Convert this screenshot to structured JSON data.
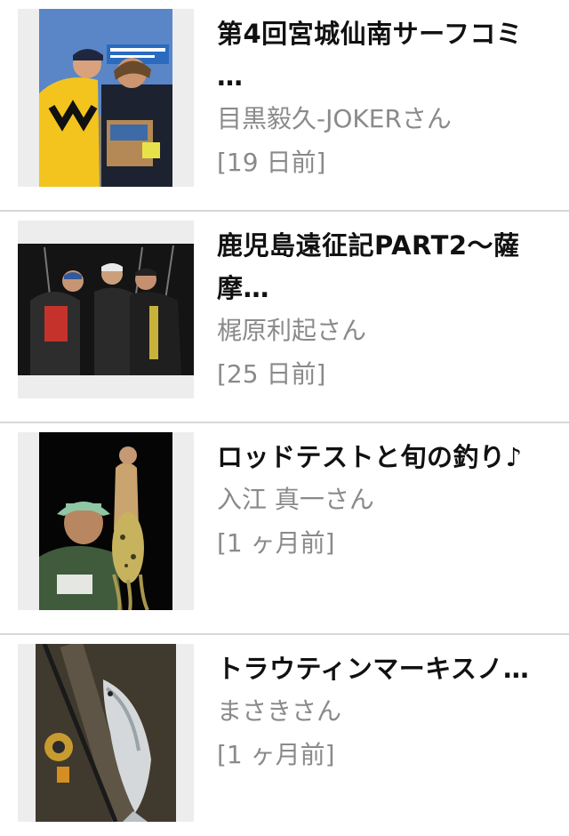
{
  "feed": {
    "items": [
      {
        "title": "第4回宮城仙南サーフコミ\n…",
        "author": "目黒毅久-JOKERさん",
        "time": "[19 日前]",
        "image": "two-men-holding-box-photo"
      },
      {
        "title": "鹿児島遠征記PART2〜薩\n摩…",
        "author": "梶原利起さん",
        "time": "[25 日前]",
        "image": "three-anglers-night-fish-photo"
      },
      {
        "title": "ロッドテストと旬の釣り♪",
        "author": "入江 真一さん",
        "time": "[1 ヶ月前]",
        "image": "man-holding-squid-photo"
      },
      {
        "title": "トラウティンマーキスノ…",
        "author": "まさきさん",
        "time": "[1 ヶ月前]",
        "image": "trout-and-reel-photo"
      }
    ]
  }
}
